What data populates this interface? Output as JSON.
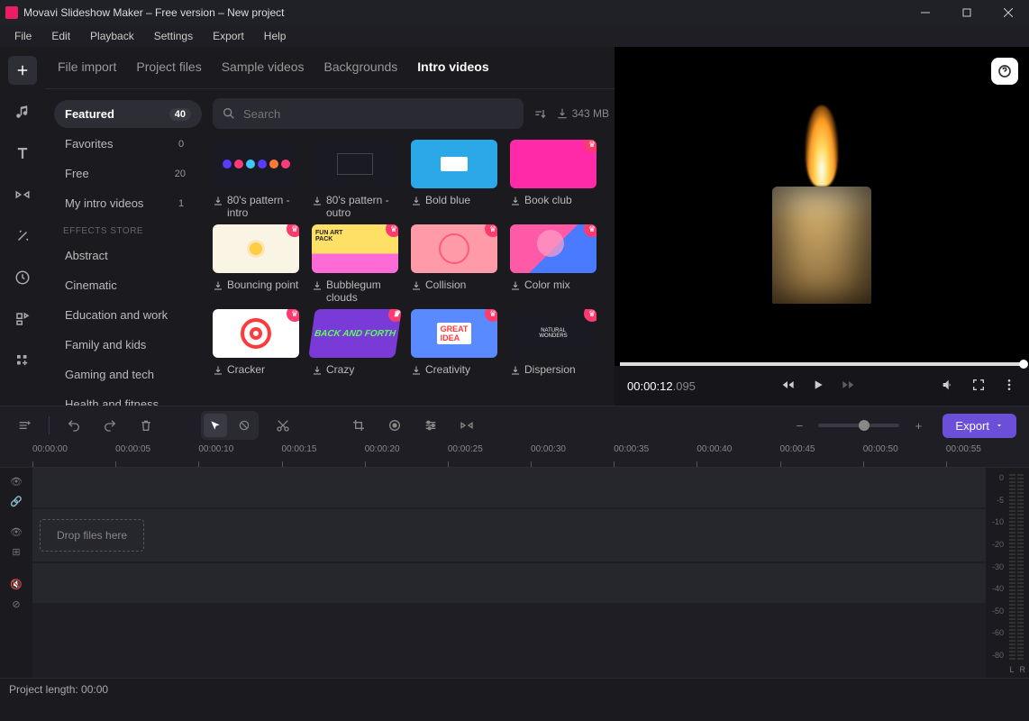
{
  "window": {
    "title": "Movavi Slideshow Maker – Free version – New project"
  },
  "menu": [
    "File",
    "Edit",
    "Playback",
    "Settings",
    "Export",
    "Help"
  ],
  "tabs": [
    "File import",
    "Project files",
    "Sample videos",
    "Backgrounds",
    "Intro videos"
  ],
  "active_tab": "Intro videos",
  "search": {
    "placeholder": "Search"
  },
  "download_size": "343 MB",
  "sidebar": {
    "items": [
      {
        "label": "Featured",
        "count": "40",
        "active": true
      },
      {
        "label": "Favorites",
        "count": "0"
      },
      {
        "label": "Free",
        "count": "20"
      },
      {
        "label": "My intro videos",
        "count": "1"
      }
    ],
    "store_header": "EFFECTS STORE",
    "store": [
      "Abstract",
      "Cinematic",
      "Education and work",
      "Family and kids",
      "Gaming and tech",
      "Health and fitness"
    ]
  },
  "cards": [
    {
      "label": "80's pattern - intro",
      "premium": false,
      "style": "t-80"
    },
    {
      "label": "80's pattern - outro",
      "premium": false,
      "style": "t-80o"
    },
    {
      "label": "Bold blue",
      "premium": false,
      "style": "t-blue"
    },
    {
      "label": "Book club",
      "premium": true,
      "style": "t-pink"
    },
    {
      "label": "Bouncing point",
      "premium": true,
      "style": "t-cream"
    },
    {
      "label": "Bubblegum clouds",
      "premium": true,
      "style": "t-fun"
    },
    {
      "label": "Collision",
      "premium": true,
      "style": "t-coll"
    },
    {
      "label": "Color mix",
      "premium": true,
      "style": "t-cmix"
    },
    {
      "label": "Cracker",
      "premium": true,
      "style": "t-crack"
    },
    {
      "label": "Crazy",
      "premium": true,
      "style": "t-crazy"
    },
    {
      "label": "Creativity",
      "premium": true,
      "style": "t-idea"
    },
    {
      "label": "Dispersion",
      "premium": true,
      "style": "t-disp"
    }
  ],
  "preview": {
    "time": "00:00:12",
    "time_ms": ".095"
  },
  "timeline": {
    "export_label": "Export",
    "marks": [
      "00:00:00",
      "00:00:05",
      "00:00:10",
      "00:00:15",
      "00:00:20",
      "00:00:25",
      "00:00:30",
      "00:00:35",
      "00:00:40",
      "00:00:45",
      "00:00:50",
      "00:00:55"
    ],
    "drop_hint": "Drop files here",
    "vu_marks": [
      "0",
      "-5",
      "-10",
      "-20",
      "-30",
      "-40",
      "-50",
      "-60",
      "-80"
    ],
    "vu_l": "L",
    "vu_r": "R"
  },
  "status": {
    "project_length": "Project length: 00:00"
  }
}
